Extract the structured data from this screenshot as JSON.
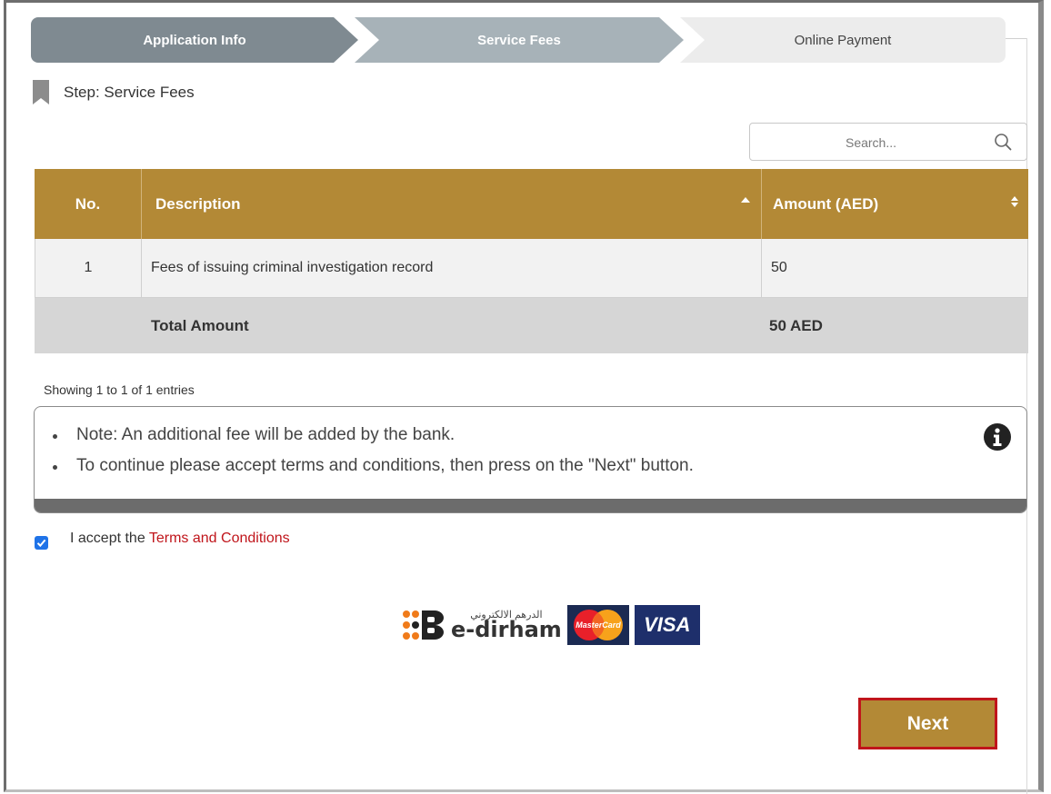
{
  "wizard": {
    "steps": [
      {
        "label": "Application Info"
      },
      {
        "label": "Service Fees"
      },
      {
        "label": "Online Payment"
      }
    ],
    "current_index": 1
  },
  "step_title": "Step: Service Fees",
  "search": {
    "placeholder": "Search...",
    "value": ""
  },
  "table": {
    "headers": {
      "no": "No.",
      "description": "Description",
      "amount": "Amount (AED)"
    },
    "rows": [
      {
        "no": "1",
        "description": "Fees of issuing criminal investigation record",
        "amount": "50"
      }
    ],
    "total_label": "Total Amount",
    "total_value": "50 AED",
    "sort": {
      "description": "ascending",
      "amount": "none"
    }
  },
  "showing_text": "Showing 1 to 1 of 1 entries",
  "note": {
    "items": [
      "Note: An additional fee will be added by the bank.",
      "To continue please accept terms and conditions, then press on the \"Next\" button."
    ],
    "icon": "info-circle-icon"
  },
  "terms": {
    "checked": true,
    "prefix": "I accept the",
    "link_text": "Terms and Conditions"
  },
  "payment": {
    "edirham_arabic": "الدرهم الالكتروني",
    "edirham_text": "e-dirham",
    "mastercard_text": "MasterCard",
    "visa_text": "VISA"
  },
  "next_button": "Next",
  "colors": {
    "accent": "#b38936",
    "link": "#c0151b",
    "step_active": "#7f8a91",
    "step_current": "#a7b2b8",
    "step_pending": "#ececec"
  }
}
